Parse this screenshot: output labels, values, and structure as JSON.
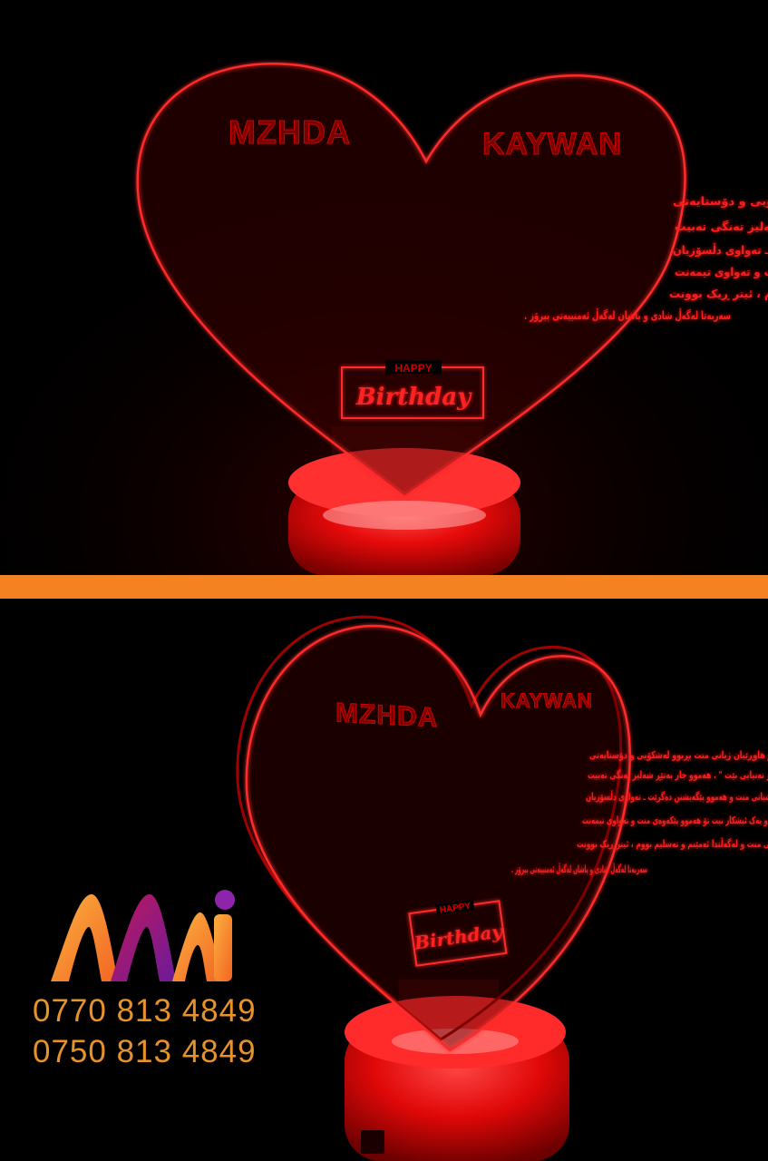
{
  "names": {
    "left": "MZHDA",
    "right": "KAYWAN"
  },
  "message_lines": [
    "ئەو ڕێگە ڕیبیتیس تاین تیدا هاتینە بوون و هاوڕێیان ژیانی منت پڕبوو لەشکۆیی و دۆستایەتی",
    "و ئێستا ریستنی و بەشتەبیرین بیت \" پیرۆز تەنیایی بێت \" . هەموو جار بەتێڕ شەلیز تەنگی تەبیت",
    "تۆ پەلەتش کەلی پێکەوەیمان بیت ـ ? تۆ ئەشیانی منت و هەموو پێگەیشتن دەگرێت ـ تەواوی دڵسۆزیان",
    "خۆشبەختی ـ تۆ یەک دڵێ و یەک هەستێ و یەک ئیشکار نیت تۆ هەموو پێکەوەی منت و تەواوی تیمەنت",
    "و من ڕوو لە تۆ ئەکەم ـ گیانم گیانی منت و لەگەڵتدا ئەمێنم و تەسلیم بووم ، ئیتر ڕیک بوونت",
    "سەربەتا لەگەڵ شادی و پاشان لەگەڵ ئەمنییەتی پیرۆز ."
  ],
  "badge": {
    "top": "HAPPY",
    "main": "Birthday"
  },
  "phones": [
    "0770 813 4849",
    "0750 813 4849"
  ],
  "colors": {
    "background": "#000000",
    "glow": "#ff1a1a",
    "divider": "#f58220",
    "phone_text": "#e8922a",
    "logo_orange": "#f7941d",
    "logo_purple": "#8e24aa"
  },
  "icons": {
    "logo": "mi-logo"
  }
}
